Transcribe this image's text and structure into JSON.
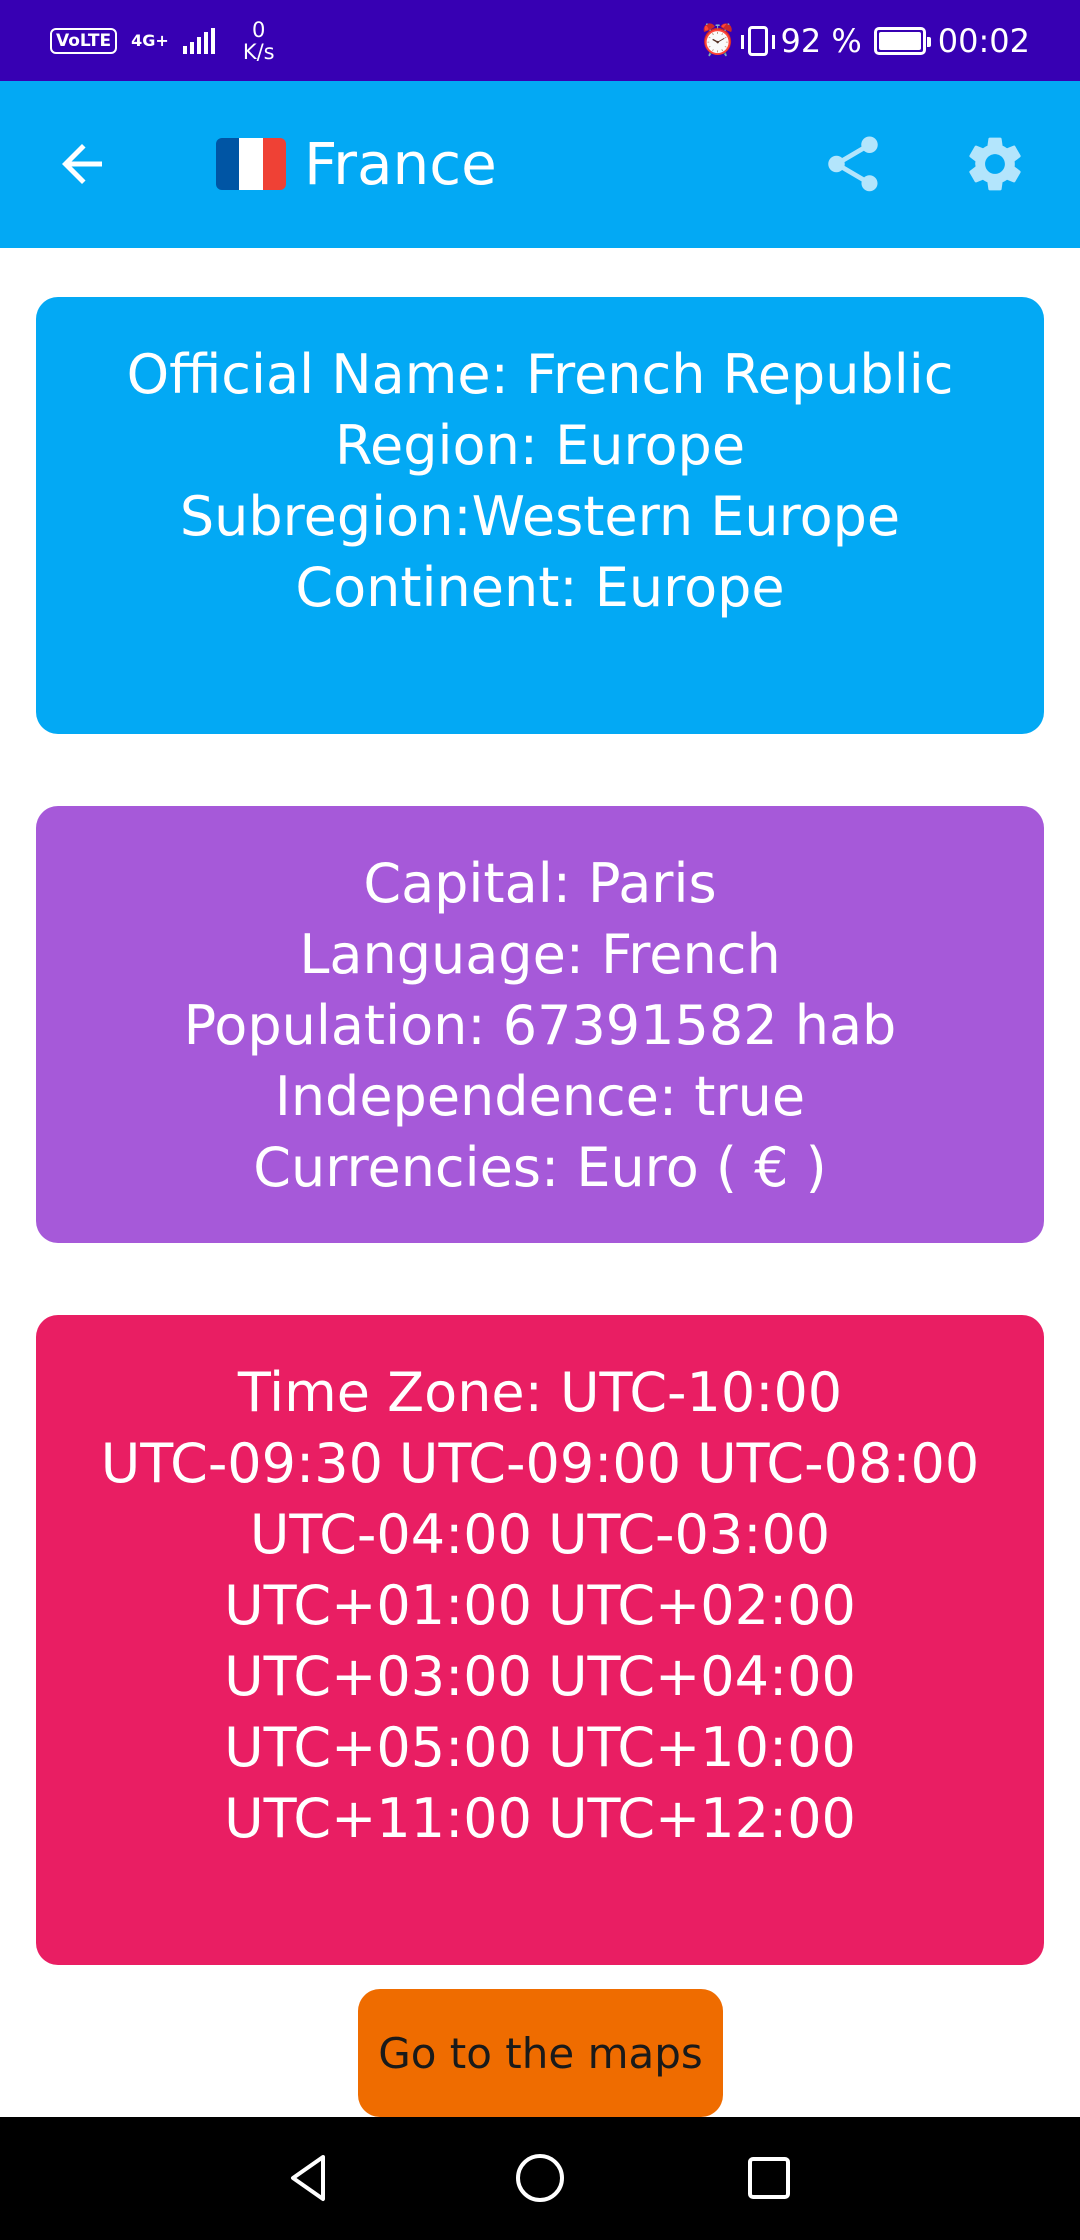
{
  "status_bar": {
    "volte": "VoLTE",
    "network": "4G+",
    "speed_value": "0",
    "speed_unit": "K/s",
    "battery_text": "92 %",
    "time": "00:02",
    "icons": [
      "alarm-icon",
      "vibrate-icon",
      "battery-charging-icon",
      "signal-icon"
    ]
  },
  "app_bar": {
    "title": "France",
    "flag_colors": [
      "#0055a4",
      "#ffffff",
      "#ef4135"
    ],
    "icons": [
      "back-arrow-icon",
      "share-icon",
      "settings-gear-icon"
    ],
    "color": "#03a9f4"
  },
  "info_card": {
    "color": "#03a9f4",
    "lines": [
      "Official Name: French Republic",
      "Region: Europe",
      "Subregion:Western Europe",
      "Continent: Europe"
    ]
  },
  "details_card": {
    "color": "#a659d9",
    "lines": [
      "Capital: Paris",
      "Language: French",
      "Population: 67391582 hab",
      "Independence: true",
      "Currencies: Euro ( € )"
    ]
  },
  "timezone_card": {
    "color": "#e91e63",
    "label": "Time Zone: UTC-10:00",
    "rows": [
      [
        "UTC-09:30",
        "UTC-09:00",
        "UTC-08:00"
      ],
      [
        "UTC-04:00",
        "UTC-03:00"
      ],
      [
        "UTC+01:00",
        "UTC+02:00"
      ],
      [
        "UTC+03:00",
        "UTC+04:00"
      ],
      [
        "UTC+05:00",
        "UTC+10:00"
      ],
      [
        "UTC+11:00",
        "UTC+12:00"
      ]
    ]
  },
  "maps_button": {
    "label": "Go to the maps",
    "color": "#ef6c00"
  },
  "nav_bar": {
    "icons": [
      "nav-back-icon",
      "nav-home-icon",
      "nav-recents-icon"
    ]
  }
}
